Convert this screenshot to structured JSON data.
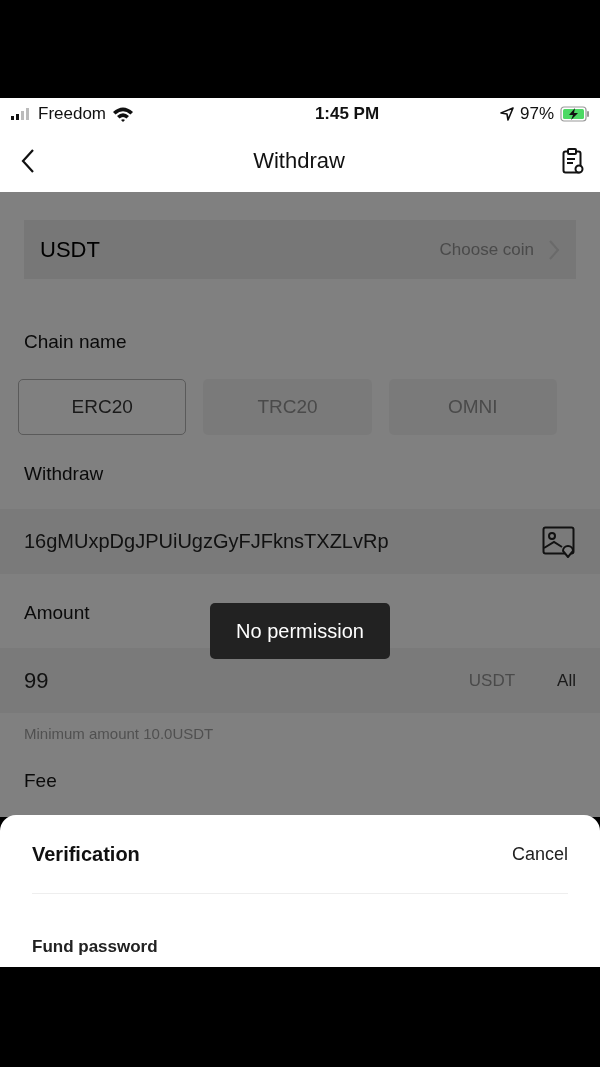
{
  "status_bar": {
    "carrier": "Freedom",
    "time": "1:45 PM",
    "battery": "97%"
  },
  "nav": {
    "title": "Withdraw"
  },
  "coin": {
    "value": "USDT",
    "action": "Choose coin"
  },
  "chain": {
    "label": "Chain name",
    "options": [
      {
        "label": "ERC20",
        "selected": true
      },
      {
        "label": "TRC20",
        "selected": false
      },
      {
        "label": "OMNI",
        "selected": false
      }
    ]
  },
  "address": {
    "label": "Withdraw",
    "value": "16gMUxpDgJPUiUgzGyFJFknsTXZLvRp"
  },
  "amount": {
    "label": "Amount",
    "value": "99",
    "unit": "USDT",
    "all": "All",
    "hint": "Minimum amount 10.0USDT"
  },
  "fee": {
    "label": "Fee"
  },
  "toast": {
    "text": "No permission"
  },
  "sheet": {
    "title": "Verification",
    "cancel": "Cancel",
    "field_label": "Fund password"
  }
}
